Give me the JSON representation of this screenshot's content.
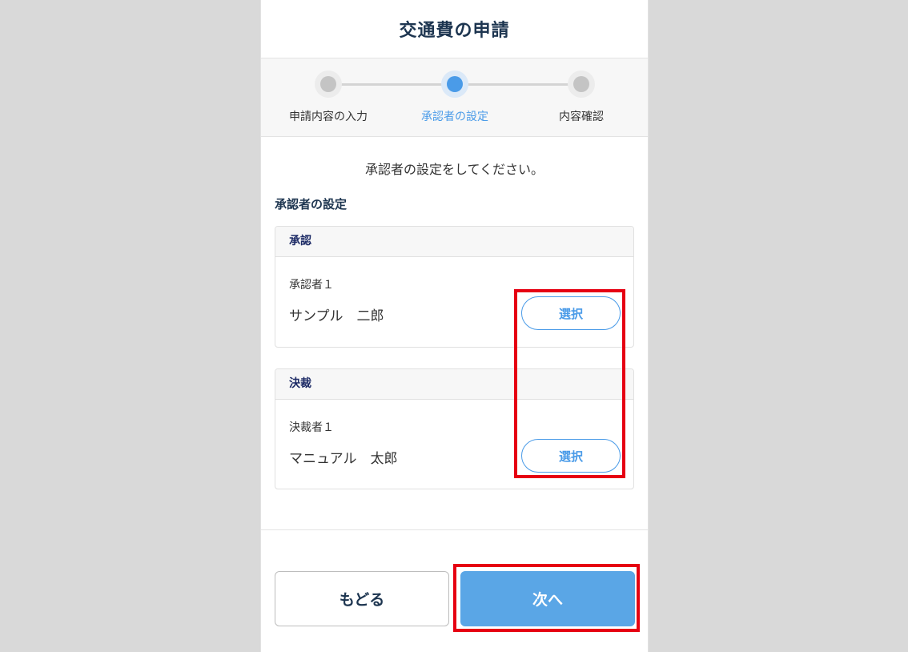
{
  "header": {
    "title": "交通費の申請"
  },
  "stepper": {
    "steps": [
      {
        "label": "申請内容の入力",
        "active": false
      },
      {
        "label": "承認者の設定",
        "active": true
      },
      {
        "label": "内容確認",
        "active": false
      }
    ]
  },
  "main": {
    "instruction": "承認者の設定をしてください。",
    "section_title": "承認者の設定",
    "cards": [
      {
        "heading": "承認",
        "role_label": "承認者１",
        "person_name": "サンプル　二郎",
        "select_label": "選択"
      },
      {
        "heading": "決裁",
        "role_label": "決裁者１",
        "person_name": "マニュアル　太郎",
        "select_label": "選択"
      }
    ]
  },
  "footer": {
    "back_label": "もどる",
    "next_label": "次へ"
  },
  "colors": {
    "accent": "#4a9be8",
    "primary_button": "#5aa6e6",
    "title_text": "#1d3550",
    "highlight": "#e60012"
  }
}
